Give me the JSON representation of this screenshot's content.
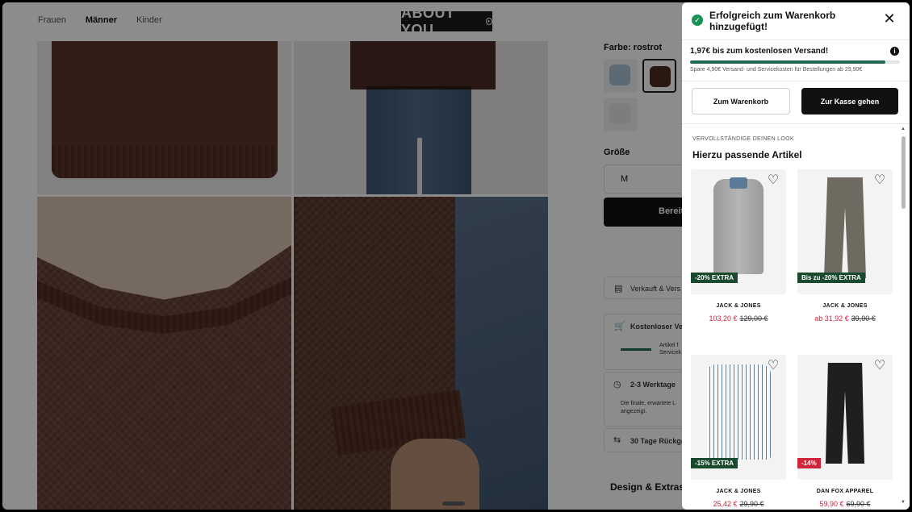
{
  "nav": {
    "items": [
      "Frauen",
      "Männer",
      "Kinder"
    ],
    "active": "Männer"
  },
  "logo": {
    "text": "ABOUT YOU"
  },
  "product": {
    "color_label": "Farbe: rostrot",
    "size_label": "Größe",
    "size_value": "M",
    "buy_label": "Bereit",
    "sold_by": "Verkauft & Vers",
    "shipping_free": "Kostenloser Ver",
    "shipping_detail": "Artikel f\nServicek",
    "delivery": "2-3 Werktage",
    "delivery_detail": "Die finale, erwartete L\nangezeigt.",
    "returns": "30 Tage Rückga",
    "design_label": "Design & Extras"
  },
  "drawer": {
    "title": "Erfolgreich zum Warenkorb hinzugefügt!",
    "shipping_title": "1,97€ bis zum kostenlosen Versand!",
    "shipping_sub": "Spare 4,90€ Versand- und Servicekosten für Bestellungen ab 29,90€",
    "shipping_progress": 0.93,
    "btn_cart": "Zum Warenkorb",
    "btn_checkout": "Zur Kasse gehen",
    "look_small": "VERVOLLSTÄNDIGE DEINEN LOOK",
    "look_title": "Hierzu passende Artikel",
    "products": [
      {
        "brand": "JACK & JONES",
        "badge": "-20% EXTRA",
        "badge_color": "#1a4a2e",
        "price": "103,20 €",
        "old_price": "129,00 €",
        "garment": "coat"
      },
      {
        "brand": "JACK & JONES",
        "badge": "Bis zu -20% EXTRA",
        "badge_color": "#1a4a2e",
        "price": "ab 31,92 €",
        "old_price": "39,90 €",
        "garment": "pants"
      },
      {
        "brand": "JACK & JONES",
        "badge": "-15% EXTRA",
        "badge_color": "#1a4a2e",
        "price": "25,42 €",
        "old_price": "29,90 €",
        "garment": "shirt"
      },
      {
        "brand": "DAN FOX APPAREL",
        "badge": "-14%",
        "badge_color": "#d1233a",
        "price": "59,90 €",
        "old_price": "69,90 €",
        "garment": "jeans"
      }
    ]
  },
  "icons": {
    "check": "check-icon",
    "close": "close-icon",
    "info": "info-icon",
    "heart": "heart-icon",
    "cart": "cart-icon",
    "clock": "clock-icon",
    "return": "return-icon",
    "store": "store-icon"
  },
  "colors": {
    "accent": "#1f6b4e",
    "sale": "#d1233a",
    "dark": "#111111"
  }
}
